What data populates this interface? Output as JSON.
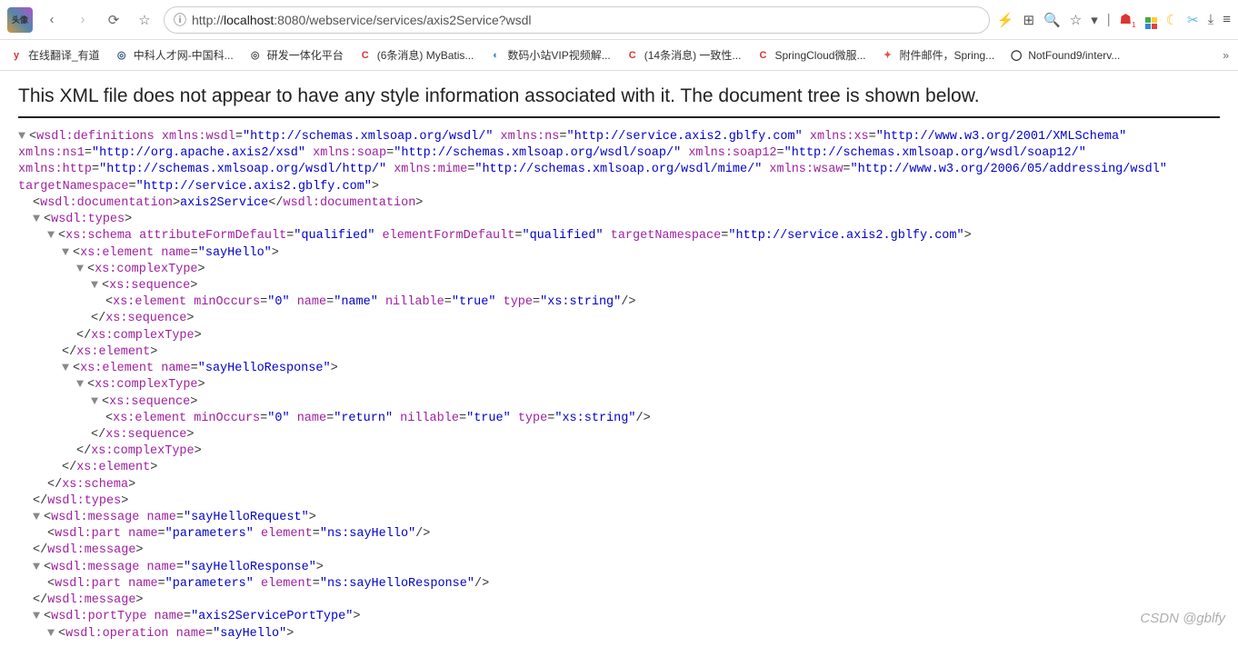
{
  "url": {
    "prefix": "http://",
    "host": "localhost",
    "rest": ":8080/webservice/services/axis2Service?wsdl"
  },
  "bookmarks": [
    {
      "label": "在线翻译_有道",
      "icon": "y",
      "color": "#d33"
    },
    {
      "label": "中科人才网-中国科...",
      "icon": "◎",
      "color": "#357"
    },
    {
      "label": "研发一体化平台",
      "icon": "◎",
      "color": "#555"
    },
    {
      "label": "(6条消息) MyBatis...",
      "icon": "C",
      "color": "#d33"
    },
    {
      "label": "数码小站VIP视频解...",
      "icon": "◐",
      "color": "#38c"
    },
    {
      "label": "(14条消息) 一致性...",
      "icon": "C",
      "color": "#d33"
    },
    {
      "label": "SpringCloud微服...",
      "icon": "C",
      "color": "#d33"
    },
    {
      "label": "附件邮件，Spring...",
      "icon": "✦",
      "color": "#d55"
    },
    {
      "label": "NotFound9/interv...",
      "icon": "◯",
      "color": "#222"
    }
  ],
  "notice": "This XML file does not appear to have any style information associated with it. The document tree is shown below.",
  "ns": {
    "wsdl": "http://schemas.xmlsoap.org/wsdl/",
    "ns": "http://service.axis2.gblfy.com",
    "xs": "http://www.w3.org/2001/XMLSchema",
    "ns1": "http://org.apache.axis2/xsd",
    "soap": "http://schemas.xmlsoap.org/wsdl/soap/",
    "soap12": "http://schemas.xmlsoap.org/wsdl/soap12/",
    "http": "http://schemas.xmlsoap.org/wsdl/http/",
    "mime": "http://schemas.xmlsoap.org/wsdl/mime/",
    "wsaw": "http://www.w3.org/2006/05/addressing/wsdl",
    "target": "http://service.axis2.gblfy.com"
  },
  "doc": "axis2Service",
  "schema": {
    "afd": "qualified",
    "efd": "qualified",
    "tns": "http://service.axis2.gblfy.com"
  },
  "el1": {
    "name": "sayHello",
    "min": "0",
    "inner": "name",
    "nil": "true",
    "type": "xs:string"
  },
  "el2": {
    "name": "sayHelloResponse",
    "min": "0",
    "inner": "return",
    "nil": "true",
    "type": "xs:string"
  },
  "msg1": {
    "name": "sayHelloRequest",
    "part": "parameters",
    "elem": "ns:sayHello"
  },
  "msg2": {
    "name": "sayHelloResponse",
    "part": "parameters",
    "elem": "ns:sayHelloResponse"
  },
  "port": {
    "name": "axis2ServicePortType",
    "op": "sayHello"
  },
  "watermark": "CSDN @gblfy"
}
